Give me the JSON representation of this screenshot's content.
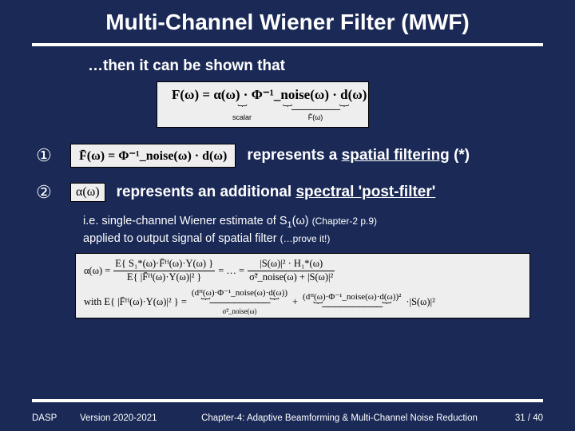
{
  "title": "Multi-Channel Wiener Filter (MWF)",
  "intro": "…then it can be shown that",
  "main_eq": {
    "expr": "F(ω) = α(ω) · Φ⁻¹_noise(ω) · d(ω)",
    "scalar_label": "scalar",
    "fbar_label": "F̄(ω)"
  },
  "item1": {
    "num": "①",
    "eq": "F̄(ω) = Φ⁻¹_noise(ω) · d(ω)",
    "text_pre": "represents a  ",
    "text_u": "spatial filtering",
    "text_post": "  (*)"
  },
  "item2": {
    "num": "②",
    "eq": "α(ω)",
    "text_pre": "represents an additional ",
    "text_u": "spectral 'post-filter'"
  },
  "explain": {
    "line1_a": "i.e. single-channel Wiener estimate of S",
    "line1_sub": "1",
    "line1_b": "(ω) ",
    "line1_ref": "(Chapter-2 p.9)",
    "line2_a": "applied to output signal of spatial filter  ",
    "line2_b": "(…prove it!)"
  },
  "bigeq": {
    "alpha": "α(ω) =",
    "num1": "E{ S₁*(ω)·F̄ᴴ(ω)·Y(ω) }",
    "den1": "E{ |F̄ᴴ(ω)·Y(ω)|² }",
    "mid": "= … =",
    "num2": "|S(ω)|² · H₁*(ω)",
    "den2": "σ̃²_noise(ω) + |S(ω)|²",
    "with": "with  E{ |F̄ᴴ(ω)·Y(ω)|² } = ",
    "term1_expr": "(dᴴ(ω)·Φ⁻¹_noise(ω)·d(ω))",
    "term1_ub": "σ̃²_noise(ω)",
    "plus": " + ",
    "term2_expr": "(dᴴ(ω)·Φ⁻¹_noise(ω)·d(ω))²",
    "term2_ub": "",
    "tail": "·|S(ω)|²"
  },
  "footer": {
    "dasp": "DASP",
    "version": "Version 2020-2021",
    "chapter": "Chapter-4: Adaptive Beamforming & Multi-Channel Noise Reduction",
    "page": "31 / 40"
  }
}
